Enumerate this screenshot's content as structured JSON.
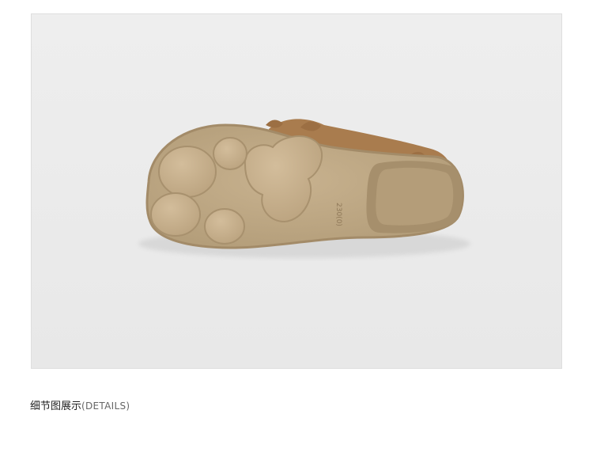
{
  "photo": {
    "subject": "shoe-sole",
    "colors": {
      "background": "#ececec",
      "sole": "#bfa884",
      "sole_edge": "#a68f6c",
      "upper": "#a87a4c",
      "pad": "#c7b08d"
    },
    "imprint_text": "230(0)"
  },
  "caption": {
    "chinese": "细节图展示",
    "english": "(DETAILS)"
  }
}
